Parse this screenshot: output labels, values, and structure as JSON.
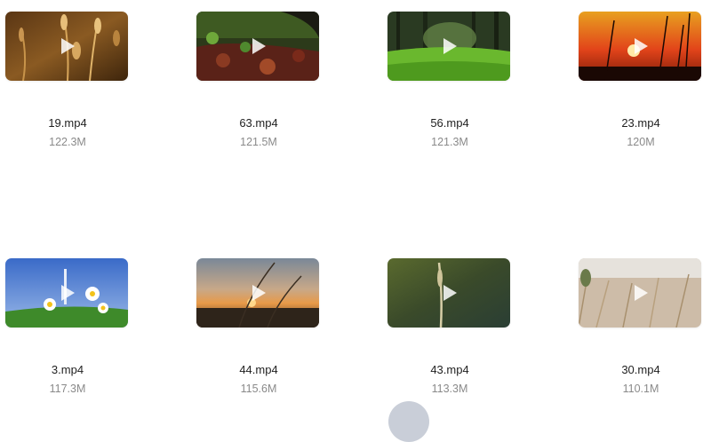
{
  "files": [
    {
      "name": "19.mp4",
      "size": "122.3M",
      "scene": "golden-grass-seedheads"
    },
    {
      "name": "63.mp4",
      "size": "121.5M",
      "scene": "forest-floor-leaves"
    },
    {
      "name": "56.mp4",
      "size": "121.3M",
      "scene": "sunlit-forest-meadow"
    },
    {
      "name": "23.mp4",
      "size": "120M",
      "scene": "red-sunset-grass"
    },
    {
      "name": "3.mp4",
      "size": "117.3M",
      "scene": "daisies-blue-sky"
    },
    {
      "name": "44.mp4",
      "size": "115.6M",
      "scene": "sunset-reeds"
    },
    {
      "name": "43.mp4",
      "size": "113.3M",
      "scene": "green-blur-grass-stem"
    },
    {
      "name": "30.mp4",
      "size": "110.1M",
      "scene": "pale-dry-grass"
    }
  ],
  "icons": {
    "play": "play-icon"
  }
}
